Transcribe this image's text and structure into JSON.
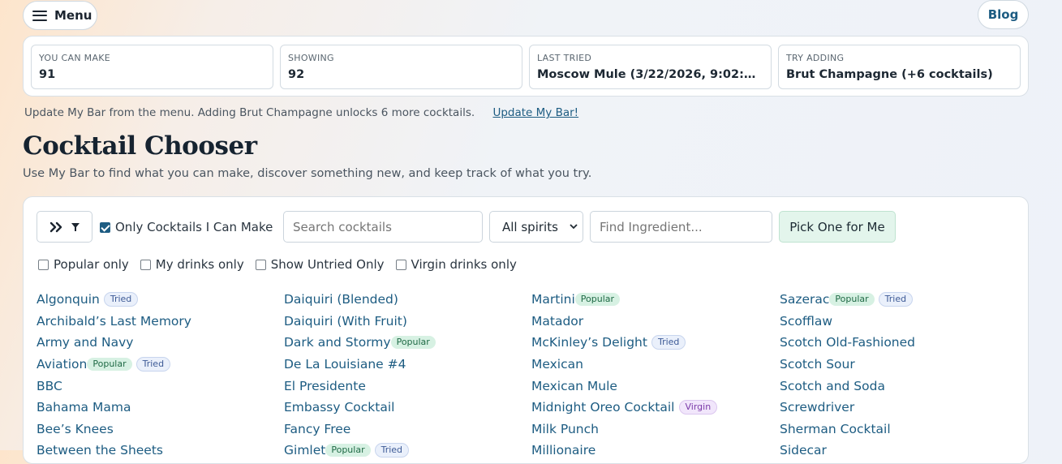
{
  "nav": {
    "menu_label": "Menu",
    "blog_label": "Blog"
  },
  "stats": [
    {
      "label": "YOU CAN MAKE",
      "value": "91"
    },
    {
      "label": "SHOWING",
      "value": "92"
    },
    {
      "label": "LAST TRIED",
      "value": "Moscow Mule (3/22/2026, 9:02:00..."
    },
    {
      "label": "TRY ADDING",
      "value": "Brut Champagne (+6 cocktails)"
    }
  ],
  "update_bar": {
    "message": "Update My Bar from the menu. Adding Brut Champagne unlocks 6 more cocktails.",
    "link_label": "Update My Bar!"
  },
  "page": {
    "title": "Cocktail Chooser",
    "subtitle": "Use My Bar to find what you can make, discover something new, and keep track of what you try."
  },
  "controls": {
    "only_can_make_label": "Only Cocktails I Can Make",
    "only_can_make_checked": true,
    "search_placeholder": "Search cocktails",
    "spirit_selected": "All spirits",
    "ingredient_placeholder": "Find Ingredient...",
    "pick_button_label": "Pick One for Me"
  },
  "filters": {
    "popular": "Popular only",
    "mine": "My drinks only",
    "untried": "Show Untried Only",
    "virgin": "Virgin drinks only"
  },
  "badge_labels": {
    "popular": "Popular",
    "tried": "Tried",
    "virgin": "Virgin"
  },
  "icons": {
    "menu": "hamburger-icon",
    "collapse": "double-chevron-right-icon",
    "filter": "funnel-icon",
    "select": "chevron-down-icon"
  },
  "colors": {
    "link": "#1d5c82",
    "popular_bg": "#d7f1e3",
    "pick_bg": "#e3f5ec"
  },
  "columns": [
    [
      {
        "name": "Algonquin",
        "badges": [
          "tried"
        ]
      },
      {
        "name": "Archibald’s Last Memory",
        "badges": []
      },
      {
        "name": "Army and Navy",
        "badges": []
      },
      {
        "name": "Aviation",
        "badges": [
          "popular",
          "tried"
        ]
      },
      {
        "name": "BBC",
        "badges": []
      },
      {
        "name": "Bahama Mama",
        "badges": []
      },
      {
        "name": "Bee’s Knees",
        "badges": []
      },
      {
        "name": "Between the Sheets",
        "badges": []
      }
    ],
    [
      {
        "name": "Daiquiri (Blended)",
        "badges": []
      },
      {
        "name": "Daiquiri (With Fruit)",
        "badges": []
      },
      {
        "name": "Dark and Stormy",
        "badges": [
          "popular"
        ]
      },
      {
        "name": "De La Louisiane #4",
        "badges": []
      },
      {
        "name": "El Presidente",
        "badges": []
      },
      {
        "name": "Embassy Cocktail",
        "badges": []
      },
      {
        "name": "Fancy Free",
        "badges": []
      },
      {
        "name": "Gimlet",
        "badges": [
          "popular",
          "tried"
        ]
      }
    ],
    [
      {
        "name": "Martini",
        "badges": [
          "popular"
        ]
      },
      {
        "name": "Matador",
        "badges": []
      },
      {
        "name": "McKinley’s Delight",
        "badges": [
          "tried"
        ]
      },
      {
        "name": "Mexican",
        "badges": []
      },
      {
        "name": "Mexican Mule",
        "badges": []
      },
      {
        "name": "Midnight Oreo Cocktail",
        "badges": [
          "virgin"
        ]
      },
      {
        "name": "Milk Punch",
        "badges": []
      },
      {
        "name": "Millionaire",
        "badges": []
      }
    ],
    [
      {
        "name": "Sazerac",
        "badges": [
          "popular",
          "tried"
        ]
      },
      {
        "name": "Scofflaw",
        "badges": []
      },
      {
        "name": "Scotch Old-Fashioned",
        "badges": []
      },
      {
        "name": "Scotch Sour",
        "badges": []
      },
      {
        "name": "Scotch and Soda",
        "badges": []
      },
      {
        "name": "Screwdriver",
        "badges": []
      },
      {
        "name": "Sherman Cocktail",
        "badges": []
      },
      {
        "name": "Sidecar",
        "badges": []
      }
    ]
  ]
}
